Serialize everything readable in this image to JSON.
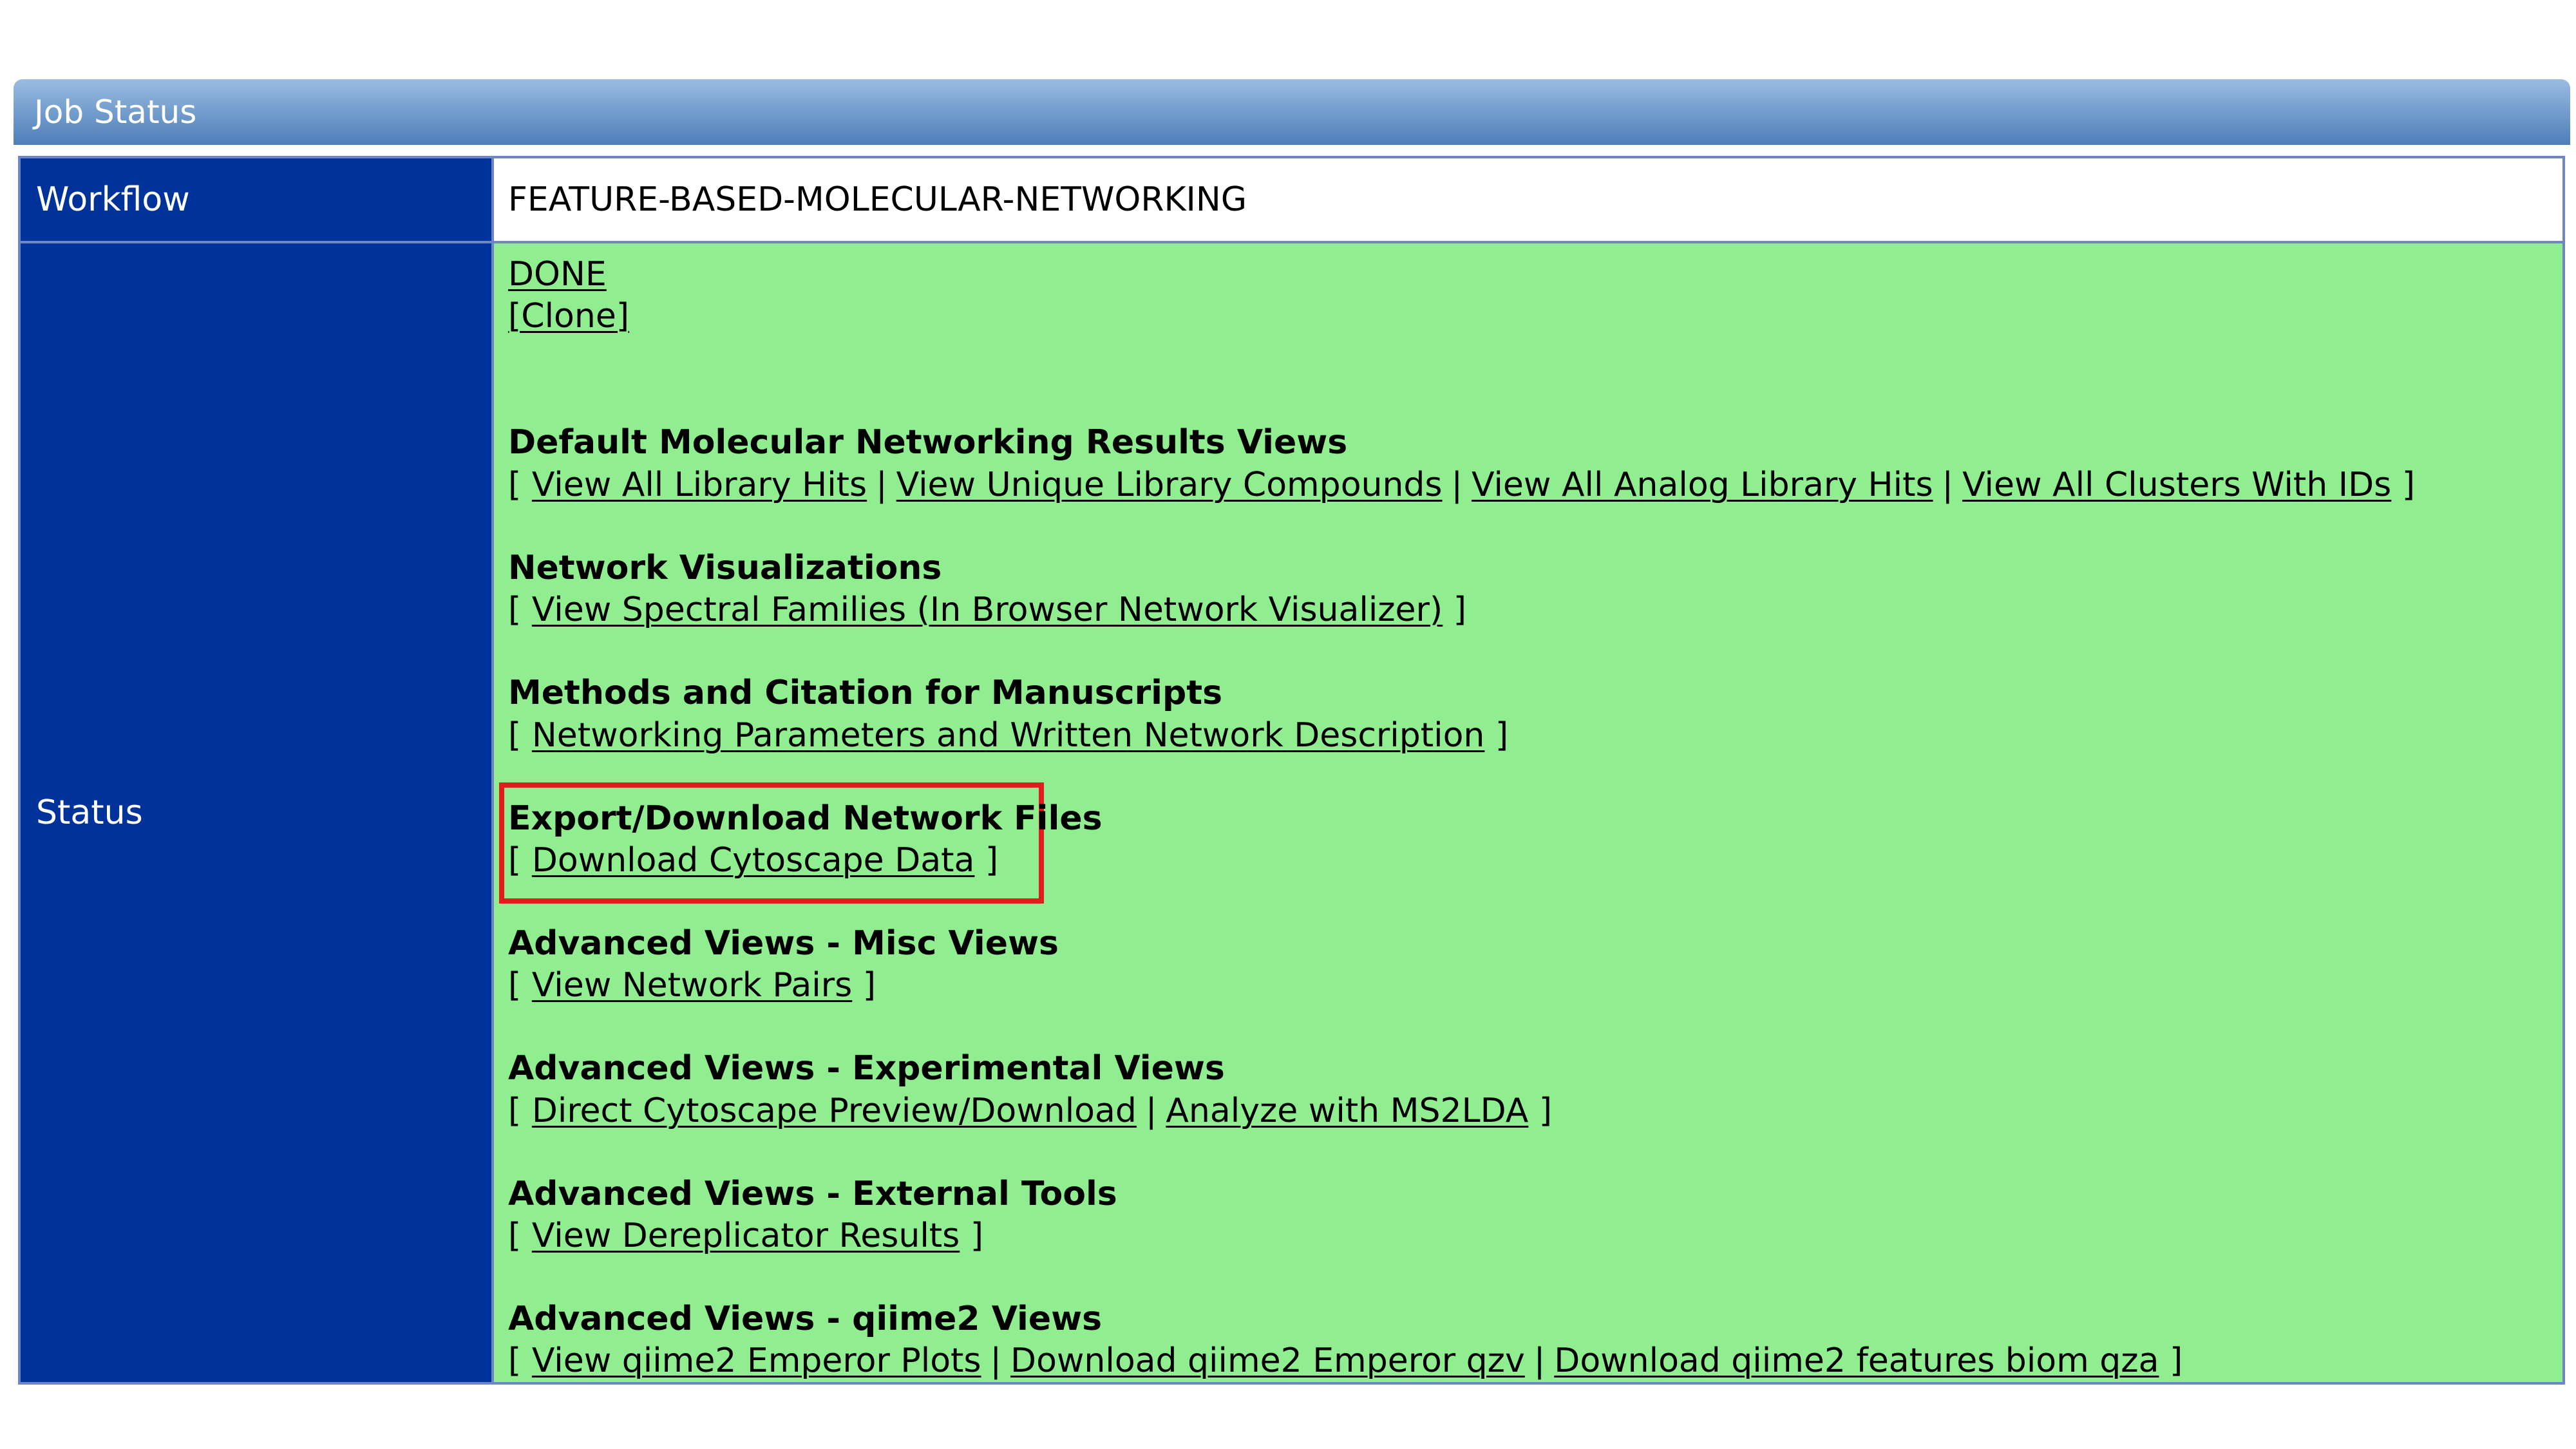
{
  "panel": {
    "title": "Job Status"
  },
  "workflow": {
    "label": "Workflow",
    "value": "FEATURE-BASED-MOLECULAR-NETWORKING"
  },
  "status": {
    "label": "Status",
    "state_link": "DONE",
    "clone_link": "[Clone]",
    "highlight_color": "#e31b1b",
    "background_color": "#90ee90",
    "sections": [
      {
        "heading": "Default Molecular Networking Results Views",
        "links": [
          "View All Library Hits",
          "View Unique Library Compounds",
          "View All Analog Library Hits",
          "View All Clusters With IDs"
        ]
      },
      {
        "heading": "Network Visualizations",
        "links": [
          "View Spectral Families (In Browser Network Visualizer)"
        ]
      },
      {
        "heading": "Methods and Citation for Manuscripts",
        "links": [
          "Networking Parameters and Written Network Description"
        ]
      },
      {
        "heading": "Export/Download Network Files",
        "links": [
          "Download Cytoscape Data"
        ]
      },
      {
        "heading": "Advanced Views - Misc Views",
        "links": [
          "View Network Pairs"
        ]
      },
      {
        "heading": "Advanced Views - Experimental Views",
        "links": [
          "Direct Cytoscape Preview/Download",
          "Analyze with MS2LDA"
        ]
      },
      {
        "heading": "Advanced Views - External Tools",
        "links": [
          "View Dereplicator Results"
        ]
      },
      {
        "heading": "Advanced Views - qiime2 Views",
        "links": [
          "View qiime2 Emperor Plots",
          "Download qiime2 Emperor qzv",
          "Download qiime2 features biom qza"
        ]
      }
    ]
  }
}
